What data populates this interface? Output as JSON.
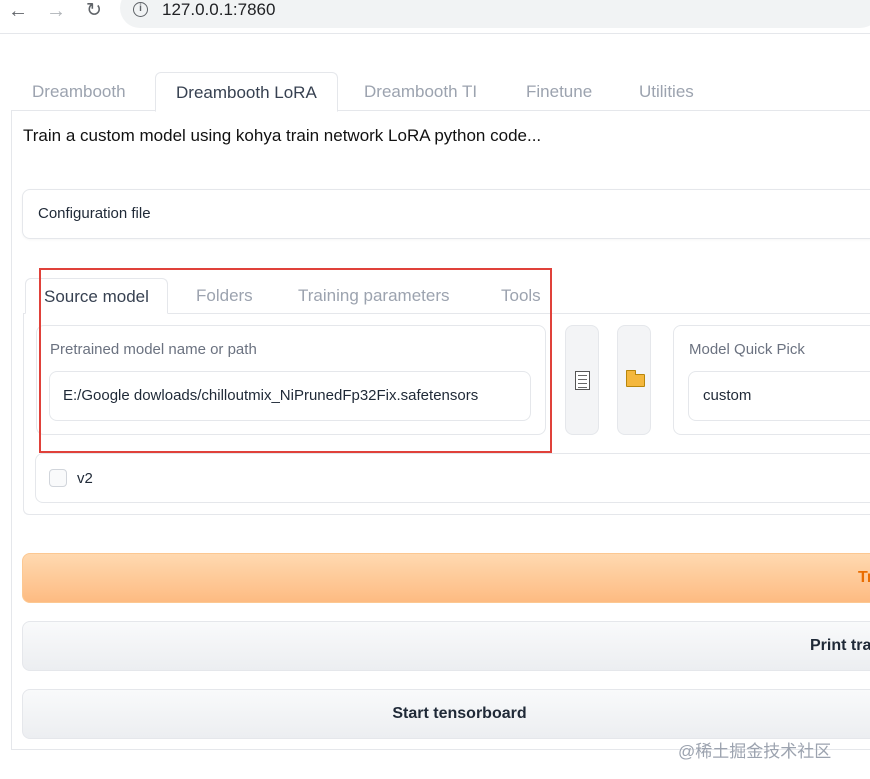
{
  "browser": {
    "url": "127.0.0.1:7860",
    "back_icon": "←",
    "forward_icon": "→",
    "reload_icon": "↻",
    "info_icon": "i"
  },
  "top_tabs": [
    {
      "label": "Dreambooth",
      "active": false
    },
    {
      "label": "Dreambooth LoRA",
      "active": true
    },
    {
      "label": "Dreambooth TI",
      "active": false
    },
    {
      "label": "Finetune",
      "active": false
    },
    {
      "label": "Utilities",
      "active": false
    }
  ],
  "description": "Train a custom model using kohya train network LoRA python code...",
  "config": {
    "label": "Configuration file"
  },
  "sub_tabs": [
    {
      "label": "Source model",
      "active": true
    },
    {
      "label": "Folders",
      "active": false
    },
    {
      "label": "Training parameters",
      "active": false
    },
    {
      "label": "Tools",
      "active": false
    }
  ],
  "pretrained": {
    "label": "Pretrained model name or path",
    "value": "E:/Google dowloads/chilloutmix_NiPrunedFp32Fix.safetensors"
  },
  "icons": {
    "file": "file-icon",
    "folder": "folder-icon"
  },
  "quick_pick": {
    "label": "Model Quick Pick",
    "value": "custom"
  },
  "v2": {
    "label": "v2",
    "checked": false
  },
  "buttons": {
    "train": "Tr",
    "print": "Print tra",
    "tensorboard": "Start tensorboard"
  },
  "watermark": "@稀土掘金技术社区",
  "colors": {
    "accent_orange": "#fdbb82",
    "highlight_red": "#e0413a"
  }
}
